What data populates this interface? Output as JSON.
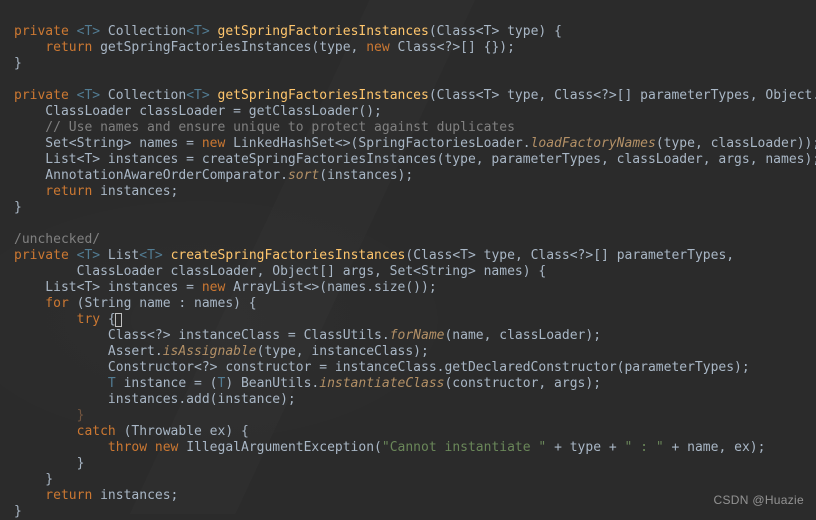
{
  "method1": {
    "sig_before": "private ",
    "generic": "<T>",
    "sig_mid": " Collection",
    "generic2": "<T>",
    "name": "getSpringFactoriesInstances",
    "params": "(Class<T> type) {",
    "ret_kw": "return",
    "ret_after": " getSpringFactoriesInstances(type, ",
    "new_kw": "new",
    "ret_tail": " Class<?>[] {});",
    "close": "}"
  },
  "method2": {
    "sig_before": "private ",
    "generic": "<T>",
    "sig_mid": " Collection",
    "generic2": "<T>",
    "name": "getSpringFactoriesInstances",
    "params": "(Class<T> type, Class<?>[] parameterTypes, Object... args) {",
    "l1": "    ClassLoader classLoader = getClassLoader();",
    "comment": "    // Use names and ensure unique to protect against duplicates",
    "l3a": "    Set<String> names = ",
    "new_kw": "new",
    "l3b": " LinkedHashSet<>(SpringFactoriesLoader.",
    "l3_italic": "loadFactoryNames",
    "l3c": "(type, classLoader));",
    "l4": "    List<T> instances = createSpringFactoriesInstances(type, parameterTypes, classLoader, args, names);",
    "l5a": "    AnnotationAwareOrderComparator.",
    "l5_italic": "sort",
    "l5b": "(instances);",
    "l6_kw": "    return",
    "l6_tail": " instances;",
    "close": "}"
  },
  "unchecked": "/unchecked/",
  "method3": {
    "sig_before": "private ",
    "generic": "<T>",
    "sig_mid": " List",
    "generic2": "<T>",
    "name": "createSpringFactoriesInstances",
    "params": "(Class<T> type, Class<?>[] parameterTypes,",
    "params2": "        ClassLoader classLoader, Object[] args, Set<String> names) {",
    "l1a": "    List<T> instances = ",
    "new_kw": "new",
    "l1b": " ArrayList<>(names.size());",
    "for_kw": "    for",
    "for_tail": " (String name : names) {",
    "try_kw": "        try",
    "try_open": " {",
    "t1a": "            Class<?> instanceClass = ClassUtils.",
    "t1_italic": "forName",
    "t1b": "(name, classLoader);",
    "t2a": "            Assert.",
    "t2_italic": "isAssignable",
    "t2b": "(type, instanceClass);",
    "t3": "            Constructor<?> constructor = instanceClass.getDeclaredConstructor(parameterTypes);",
    "t4a": "            ",
    "t4_gen": "T",
    "t4b": " instance = (",
    "t4_gen2": "T",
    "t4c": ") BeanUtils.",
    "t4_italic": "instantiateClass",
    "t4d": "(constructor, args);",
    "t5": "            instances.add(instance);",
    "try_close": "        }",
    "catch_kw": "        catch",
    "catch_tail": " (Throwable ex) {",
    "c1_kw": "            throw new",
    "c1_mid": " IllegalArgumentException(",
    "c1_str1": "\"Cannot instantiate \"",
    "c1_mid2": " + type + ",
    "c1_str2": "\" : \"",
    "c1_tail": " + name, ex);",
    "catch_close": "        }",
    "for_close": "    }",
    "ret_kw": "    return",
    "ret_tail": " instances;",
    "close": "}"
  },
  "watermark": "CSDN @Huazie"
}
